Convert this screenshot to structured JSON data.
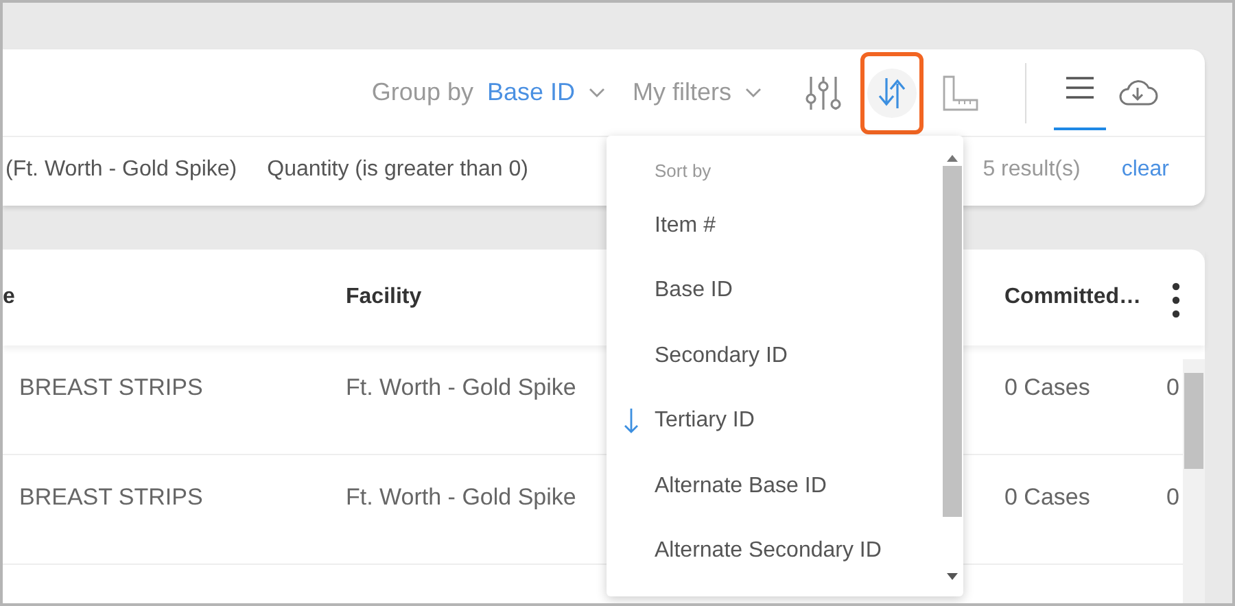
{
  "toolbar": {
    "group_by": {
      "label": "Group by",
      "value": "Base ID"
    },
    "my_filters": {
      "label": "My filters"
    },
    "tools": [
      {
        "kind": "filters",
        "selected": false
      },
      {
        "kind": "sort",
        "selected": true
      },
      {
        "kind": "ruler",
        "selected": false
      }
    ],
    "views": [
      {
        "kind": "list",
        "selected": true
      },
      {
        "kind": "download",
        "selected": false
      }
    ]
  },
  "filters": {
    "chips": [
      "(Ft. Worth - Gold Spike)",
      "Quantity (is greater than 0)"
    ],
    "result_count": "5 result(s)",
    "clear": "clear"
  },
  "sort_menu": {
    "heading": "Sort by",
    "items": [
      {
        "label": "Item #",
        "selected": false
      },
      {
        "label": "Base ID",
        "selected": false
      },
      {
        "label": "Secondary ID",
        "selected": false
      },
      {
        "label": "Tertiary ID",
        "selected": true
      },
      {
        "label": "Alternate Base ID",
        "selected": false
      },
      {
        "label": "Alternate Secondary ID",
        "selected": false
      }
    ]
  },
  "table": {
    "columns": [
      "e",
      "Facility",
      "Committed…"
    ],
    "rows": [
      {
        "column_1": "BREAST STRIPS",
        "facility": "Ft. Worth - Gold Spike",
        "committed": "0 Cases",
        "column_5": "0"
      },
      {
        "column_1": "BREAST STRIPS",
        "facility": "Ft. Worth - Gold Spike",
        "committed": "0 Cases",
        "column_5": "0"
      }
    ]
  }
}
